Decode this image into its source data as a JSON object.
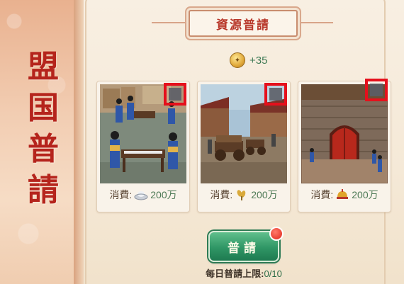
{
  "sidebar": {
    "title_chars": [
      "盟",
      "国",
      "普",
      "請"
    ]
  },
  "header": {
    "title": "資源普請"
  },
  "reward": {
    "icon": "gold-coin-icon",
    "amount": "+35"
  },
  "cards": [
    {
      "scene": "court-officials-scene",
      "cost_label": "消費:",
      "cost_icon": "silver-ingot-icon",
      "cost_value": "200万"
    },
    {
      "scene": "supply-wagons-scene",
      "cost_label": "消費:",
      "cost_icon": "grain-icon",
      "cost_value": "200万"
    },
    {
      "scene": "city-gate-scene",
      "cost_label": "消費:",
      "cost_icon": "soldier-helmet-icon",
      "cost_value": "200万"
    }
  ],
  "actions": {
    "claim_label": "普請",
    "has_notification": true
  },
  "daily_limit": {
    "label": "每日普請上限:",
    "value": "0/10"
  },
  "colors": {
    "accent_red": "#b5241c",
    "button_green": "#2f9665",
    "highlight": "#e5101c"
  }
}
